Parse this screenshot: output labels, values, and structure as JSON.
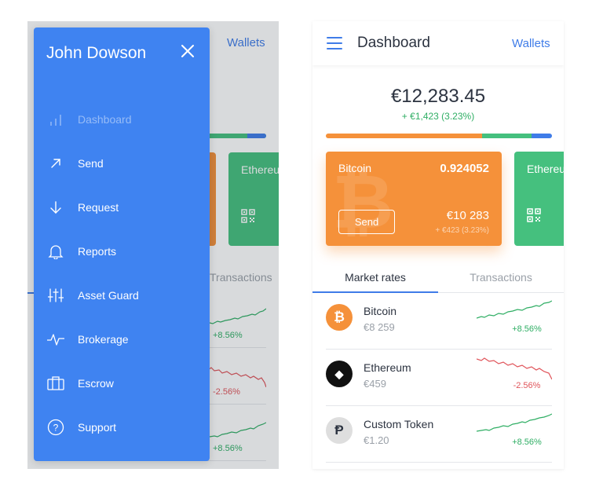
{
  "menu": {
    "user_name": "John Dowson",
    "items": [
      {
        "label": "Dashboard",
        "icon": "bar-chart-icon",
        "active": true
      },
      {
        "label": "Send",
        "icon": "arrow-up-right-icon"
      },
      {
        "label": "Request",
        "icon": "arrow-down-icon"
      },
      {
        "label": "Reports",
        "icon": "bell-icon"
      },
      {
        "label": "Asset Guard",
        "icon": "sliders-icon"
      },
      {
        "label": "Brokerage",
        "icon": "pulse-icon"
      },
      {
        "label": "Escrow",
        "icon": "briefcase-icon"
      },
      {
        "label": "Support",
        "icon": "help-circle-icon"
      }
    ]
  },
  "header": {
    "title": "Dashboard",
    "wallets_link": "Wallets"
  },
  "portfolio": {
    "total": "€12,283.45",
    "change": "+ €1,423 (3.23%)",
    "allocation": [
      {
        "color": "#f5913a",
        "share": 0.69
      },
      {
        "color": "#45c07e",
        "share": 0.22
      },
      {
        "color": "#3f7ce8",
        "share": 0.09
      }
    ]
  },
  "wallets": [
    {
      "name": "Bitcoin",
      "amount": "0.924052",
      "value": "€10 283",
      "change": "+ €423 (3.23%)",
      "send_label": "Send",
      "color": "#f5913a",
      "symbol": "₿"
    },
    {
      "name": "Ethereum",
      "color": "#45c07e",
      "icon": "qr-code-icon"
    }
  ],
  "tabs": [
    {
      "label": "Market rates",
      "active": true
    },
    {
      "label": "Transactions",
      "active": false
    }
  ],
  "markets": [
    {
      "name": "Bitcoin",
      "price": "€8 259",
      "change": "+8.56%",
      "trend": "up",
      "color": "#2fae64",
      "coin_bg": "#f5913a",
      "symbol": "₿",
      "icon": "bitcoin-icon"
    },
    {
      "name": "Ethereum",
      "price": "€459",
      "change": "-2.56%",
      "trend": "down",
      "color": "#e0545a",
      "coin_bg": "#111111",
      "symbol": "◆",
      "icon": "ethereum-icon"
    },
    {
      "name": "Custom Token",
      "price": "€1.20",
      "change": "+8.56%",
      "trend": "up",
      "color": "#2fae64",
      "coin_bg": "#dedede",
      "symbol": "Ᵽ",
      "icon": "custom-token-icon"
    }
  ]
}
